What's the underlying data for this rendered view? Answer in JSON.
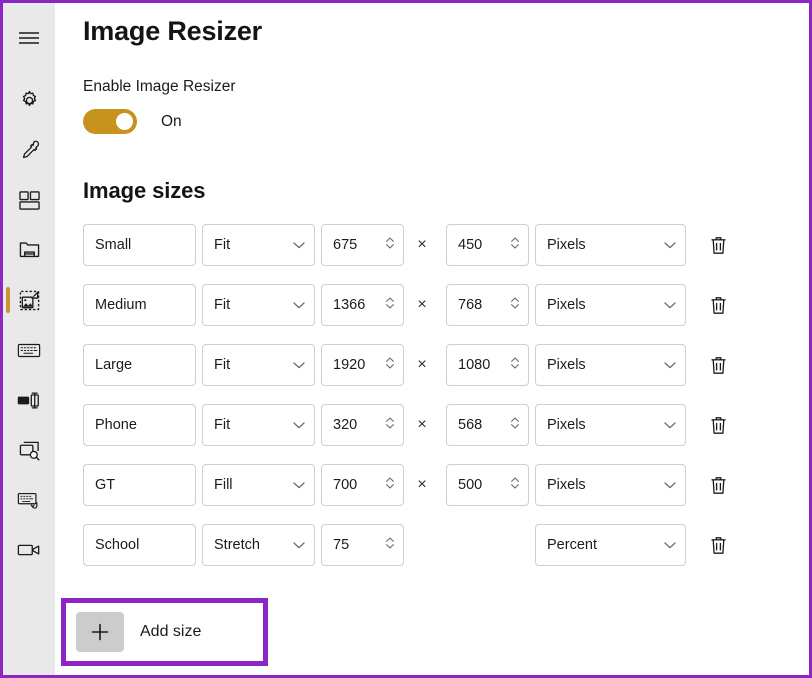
{
  "window": {
    "accent_highlight_color": "#8a27c4",
    "sidebar_bg": "#e9e9e9",
    "toggle_on_color": "#c8921f",
    "selection_indicator_color": "#c7933b"
  },
  "sidebar": {
    "menu_label": "Navigation menu",
    "items": [
      {
        "id": "hamburger",
        "icon": "hamburger-menu-icon",
        "label": "Menu"
      },
      {
        "id": "settings",
        "icon": "gear-icon",
        "label": "General"
      },
      {
        "id": "color-picker",
        "icon": "eyedropper-icon",
        "label": "Color Picker"
      },
      {
        "id": "fancy-zones",
        "icon": "layout-grid-icon",
        "label": "FancyZones"
      },
      {
        "id": "file-explorer",
        "icon": "file-explorer-icon",
        "label": "File Explorer"
      },
      {
        "id": "image-resizer",
        "icon": "image-resizer-icon",
        "label": "Image Resizer",
        "selected": true
      },
      {
        "id": "keyboard-manager",
        "icon": "keyboard-icon",
        "label": "Keyboard Manager"
      },
      {
        "id": "power-rename",
        "icon": "rename-icon",
        "label": "PowerRename"
      },
      {
        "id": "powertoys-run",
        "icon": "search-window-icon",
        "label": "PowerToys Run"
      },
      {
        "id": "shortcut-guide",
        "icon": "keyboard-shortcut-icon",
        "label": "Shortcut Guide"
      },
      {
        "id": "video-conference",
        "icon": "video-camera-icon",
        "label": "Video Conference Mute"
      }
    ]
  },
  "page": {
    "title": "Image Resizer",
    "enable_label": "Enable Image Resizer",
    "toggle_state": "On",
    "section_title": "Image sizes",
    "x_separator": "×",
    "delete_icon": "trash-icon",
    "chevron_icon": "chevron-down-icon",
    "spinner_icon": "spinner-updown-icon"
  },
  "sizes": [
    {
      "name": "Small",
      "fit": "Fit",
      "width": "675",
      "height": "450",
      "unit": "Pixels",
      "has_height": true
    },
    {
      "name": "Medium",
      "fit": "Fit",
      "width": "1366",
      "height": "768",
      "unit": "Pixels",
      "has_height": true
    },
    {
      "name": "Large",
      "fit": "Fit",
      "width": "1920",
      "height": "1080",
      "unit": "Pixels",
      "has_height": true
    },
    {
      "name": "Phone",
      "fit": "Fit",
      "width": "320",
      "height": "568",
      "unit": "Pixels",
      "has_height": true
    },
    {
      "name": "GT",
      "fit": "Fill",
      "width": "700",
      "height": "500",
      "unit": "Pixels",
      "has_height": true
    },
    {
      "name": "School",
      "fit": "Stretch",
      "width": "75",
      "height": "",
      "unit": "Percent",
      "has_height": false
    }
  ],
  "add_size": {
    "label": "Add size",
    "icon": "plus-icon"
  }
}
